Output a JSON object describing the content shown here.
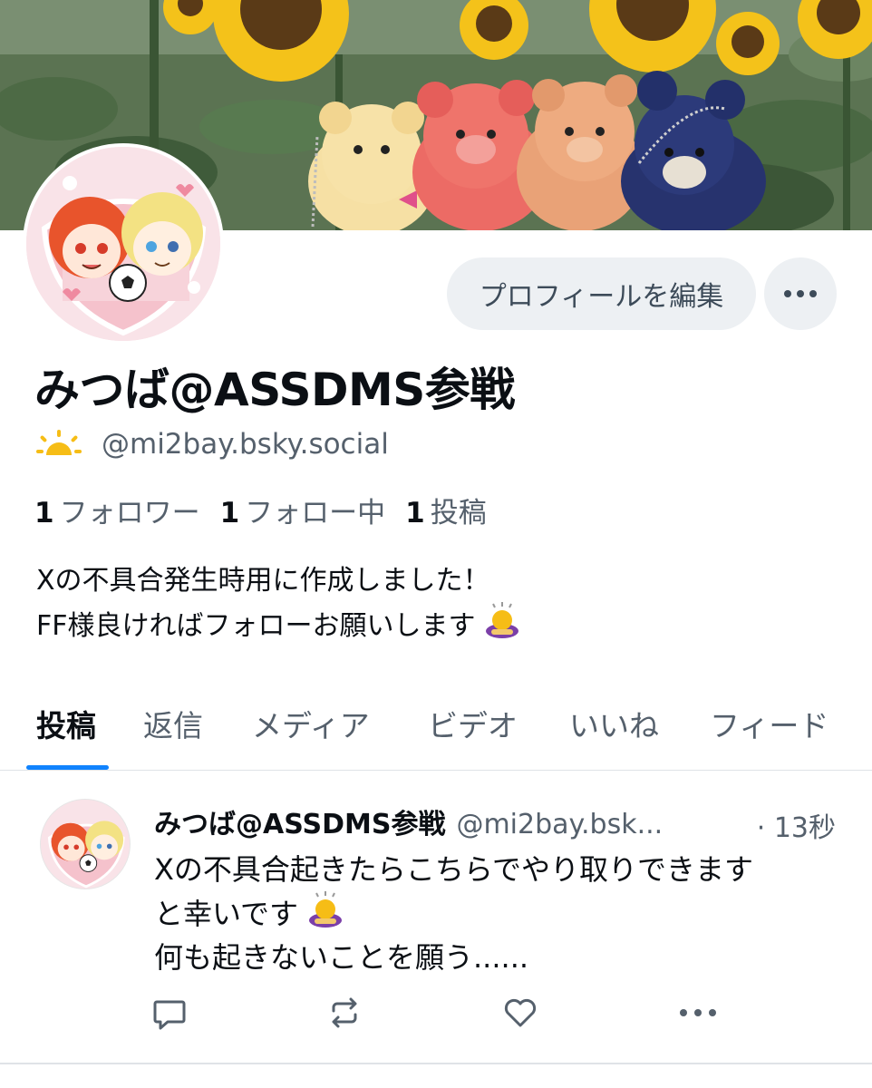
{
  "profile": {
    "display_name": "みつば@ASSDMS参戦",
    "handle": "@mi2bay.bsky.social",
    "edit_profile_label": "プロフィールを編集",
    "stats": [
      {
        "count": "1",
        "label": "フォロワー"
      },
      {
        "count": "1",
        "label": "フォロー中"
      },
      {
        "count": "1",
        "label": "投稿"
      }
    ],
    "bio_line1": "Xの不具合発生時用に作成しました！",
    "bio_line2": "FF様良ければフォローお願いします"
  },
  "tabs": [
    {
      "label": "投稿",
      "active": true
    },
    {
      "label": "返信",
      "active": false
    },
    {
      "label": "メディア",
      "active": false
    },
    {
      "label": "ビデオ",
      "active": false
    },
    {
      "label": "いいね",
      "active": false
    },
    {
      "label": "フィード",
      "active": false
    }
  ],
  "post": {
    "author_name": "みつば@ASSDMS参戦",
    "author_handle": "@mi2bay.bsk...",
    "time": "· 13秒",
    "line1": "Xの不具合起きたらこちらでやり取りできます",
    "line2": "と幸いです",
    "line3": "何も起きないことを願う......"
  },
  "icons": {
    "sun": "sunrise-icon",
    "more": "more-dots-icon",
    "bow_emoji": "person-bowing-emoji",
    "reply": "reply-icon",
    "repost": "repost-icon",
    "like": "heart-icon",
    "post_more": "more-dots-icon"
  },
  "colors": {
    "accent": "#1083fe",
    "muted_text": "#55606c",
    "button_bg": "#edf0f3",
    "sun_yellow": "#f6bd16"
  }
}
